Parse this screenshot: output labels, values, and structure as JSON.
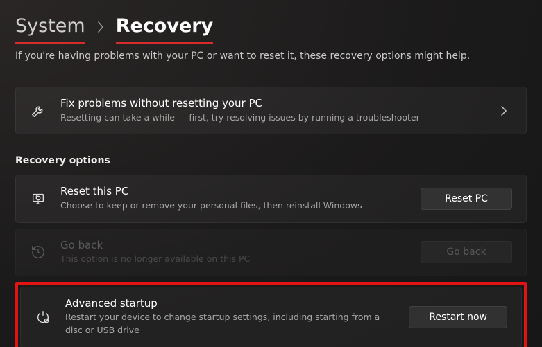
{
  "breadcrumb": {
    "parent": "System",
    "current": "Recovery"
  },
  "subtitle": "If you're having problems with your PC or want to reset it, these recovery options might help.",
  "troubleshooter_card": {
    "title": "Fix problems without resetting your PC",
    "desc": "Resetting can take a while — first, try resolving issues by running a troubleshooter"
  },
  "section_title": "Recovery options",
  "reset_card": {
    "title": "Reset this PC",
    "desc": "Choose to keep or remove your personal files, then reinstall Windows",
    "button": "Reset PC"
  },
  "goback_card": {
    "title": "Go back",
    "desc": "This option is no longer available on this PC",
    "button": "Go back"
  },
  "advstartup_card": {
    "title": "Advanced startup",
    "desc": "Restart your device to change startup settings, including starting from a disc or USB drive",
    "button": "Restart now"
  }
}
